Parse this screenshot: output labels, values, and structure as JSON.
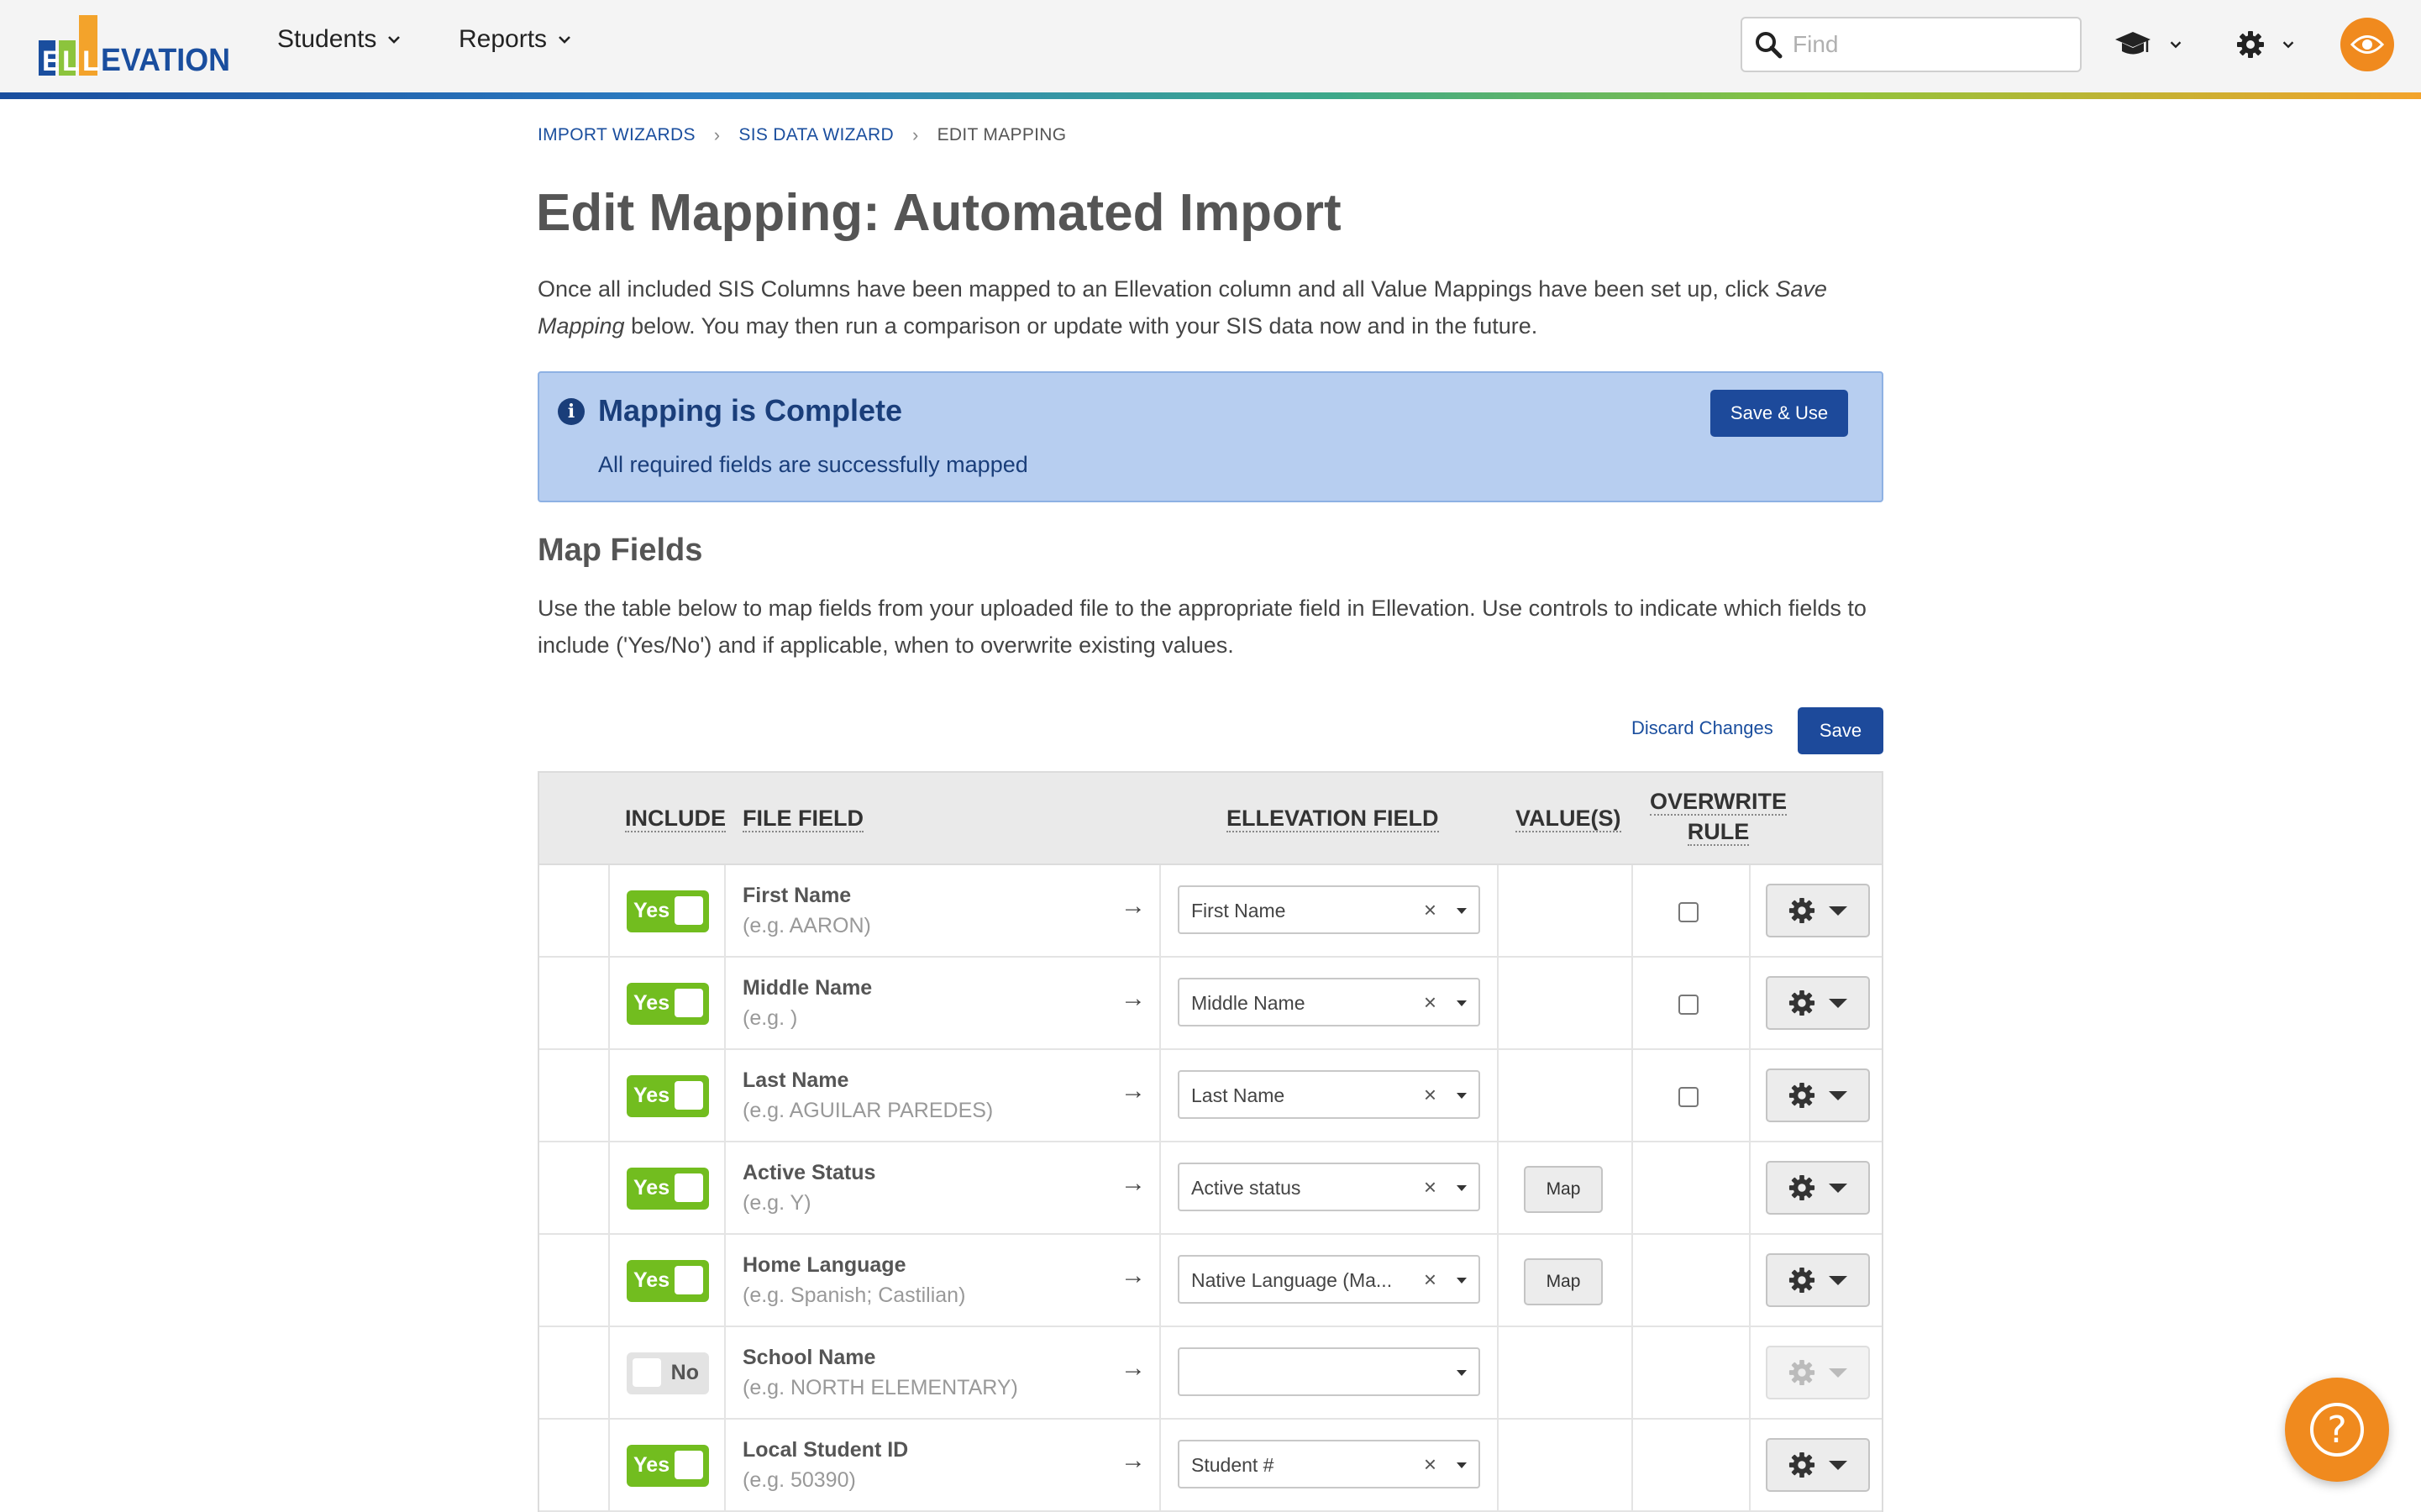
{
  "nav": {
    "logo_text": "ELLEVATION",
    "menus": [
      {
        "label": "Students"
      },
      {
        "label": "Reports"
      }
    ],
    "search_placeholder": "Find",
    "icons": [
      "search-icon",
      "graduation-cap-icon",
      "gear-icon",
      "eye-icon"
    ]
  },
  "breadcrumb": {
    "items": [
      "IMPORT WIZARDS",
      "SIS DATA WIZARD"
    ],
    "current": "EDIT MAPPING",
    "separator": "›"
  },
  "page": {
    "title": "Edit Mapping: Automated Import",
    "intro_part1": "Once all included SIS Columns have been mapped to an Ellevation column and all Value Mappings have been set up, click ",
    "intro_em": "Save Mapping",
    "intro_part2": " below. You may then run a comparison or update with your SIS data now and in the future."
  },
  "alert": {
    "title": "Mapping is Complete",
    "text": "All required fields are successfully mapped",
    "button": "Save & Use"
  },
  "map_fields": {
    "title": "Map Fields",
    "description": "Use the table below to map fields from your uploaded file to the appropriate field in Ellevation. Use controls to indicate which fields to include ('Yes/No') and if applicable, when to overwrite existing values.",
    "discard_label": "Discard Changes",
    "save_label": "Save"
  },
  "table": {
    "headers": {
      "include": "INCLUDE",
      "file_field": "FILE FIELD",
      "ellevation_field": "ELLEVATION FIELD",
      "values": "VALUE(S)",
      "overwrite_1": "OVERWRITE",
      "overwrite_2": "RULE"
    },
    "rows": [
      {
        "include": "Yes",
        "on": true,
        "field": "First Name",
        "example": "(e.g. AARON)",
        "mapped": "First Name",
        "clear": "×",
        "map_btn": "",
        "checkbox": true,
        "gear_enabled": true
      },
      {
        "include": "Yes",
        "on": true,
        "field": "Middle Name",
        "example": "(e.g. )",
        "mapped": "Middle Name",
        "clear": "×",
        "map_btn": "",
        "checkbox": true,
        "gear_enabled": true
      },
      {
        "include": "Yes",
        "on": true,
        "field": "Last Name",
        "example": "(e.g. AGUILAR PAREDES)",
        "mapped": "Last Name",
        "clear": "×",
        "map_btn": "",
        "checkbox": true,
        "gear_enabled": true
      },
      {
        "include": "Yes",
        "on": true,
        "field": "Active Status",
        "example": "(e.g. Y)",
        "mapped": "Active status",
        "clear": "×",
        "map_btn": "Map",
        "checkbox": false,
        "gear_enabled": true
      },
      {
        "include": "Yes",
        "on": true,
        "field": "Home Language",
        "example": "(e.g. Spanish; Castilian)",
        "mapped": "Native Language (Ma...",
        "clear": "×",
        "map_btn": "Map",
        "checkbox": false,
        "gear_enabled": true
      },
      {
        "include": "No",
        "on": false,
        "field": "School Name",
        "example": "(e.g. NORTH ELEMENTARY)",
        "mapped": "",
        "clear": "",
        "map_btn": "",
        "checkbox": false,
        "gear_enabled": false
      },
      {
        "include": "Yes",
        "on": true,
        "field": "Local Student ID",
        "example": "(e.g. 50390)",
        "mapped": "Student #",
        "clear": "×",
        "map_btn": "",
        "checkbox": false,
        "gear_enabled": true
      }
    ],
    "arrow": "→"
  },
  "help_button": {
    "label": "?"
  },
  "colors": {
    "brand_blue": "#1d4a9b",
    "toggle_on": "#72bd1f",
    "accent_orange": "#f08a1e",
    "alert_bg": "#b7cef0"
  }
}
